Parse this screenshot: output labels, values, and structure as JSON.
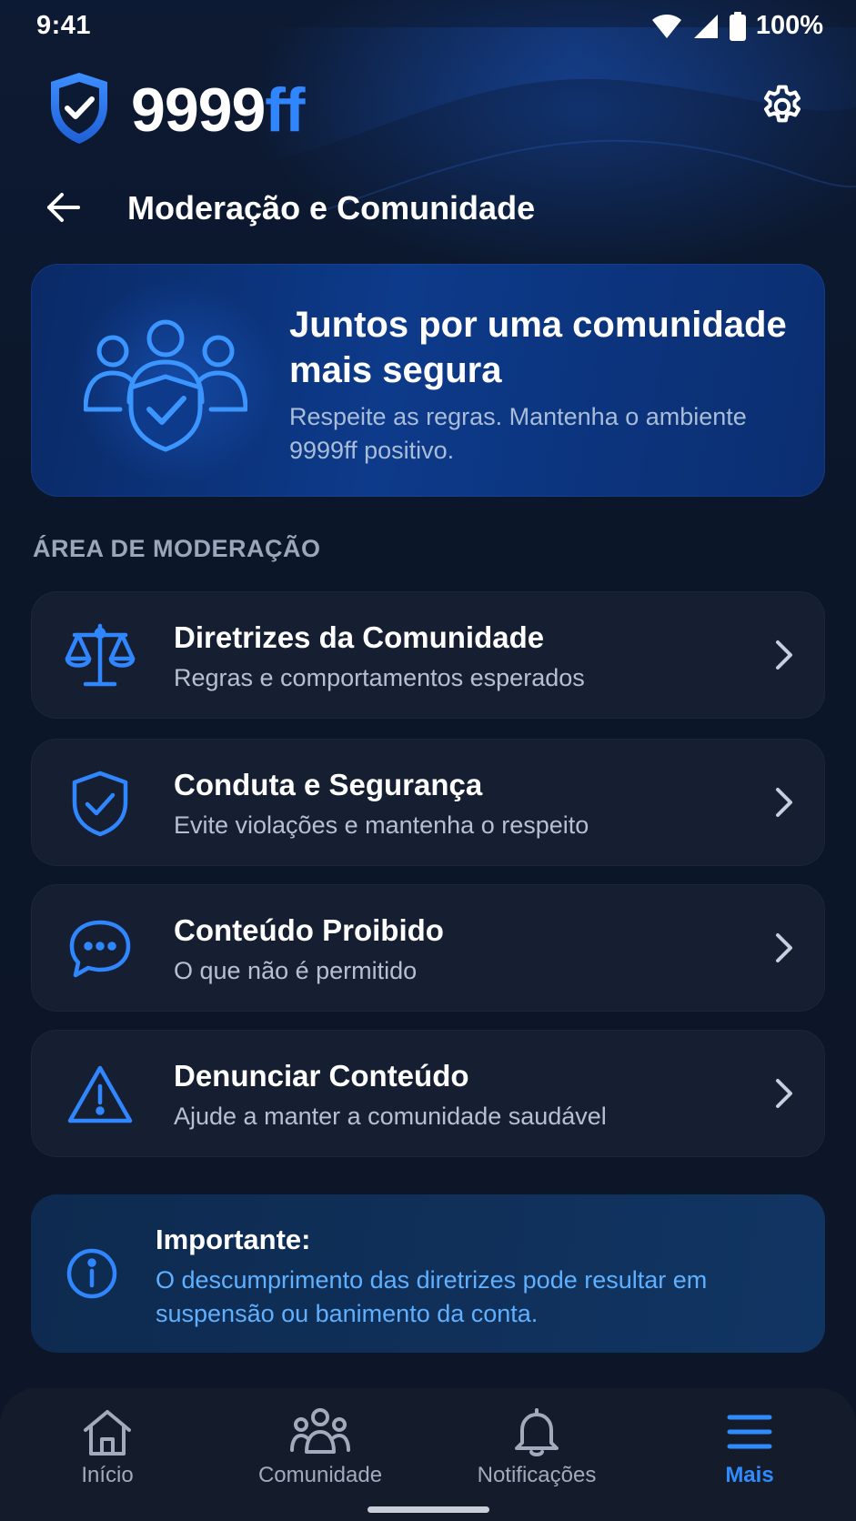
{
  "status_bar": {
    "time": "9:41",
    "battery": "100%"
  },
  "header": {
    "brand_main": "9999",
    "brand_accent": "ff"
  },
  "page": {
    "title": "Moderação e Comunidade"
  },
  "hero": {
    "title": "Juntos por uma comunidade mais segura",
    "subtitle": "Respeite as regras. Mantenha o ambiente 9999ff positivo."
  },
  "section": {
    "label": "ÁREA DE MODERAÇÃO"
  },
  "items": [
    {
      "title": "Diretrizes da Comunidade",
      "subtitle": "Regras e comportamentos esperados",
      "icon": "scale-icon"
    },
    {
      "title": "Conduta e Segurança",
      "subtitle": "Evite violações e mantenha o respeito",
      "icon": "shield-check-icon"
    },
    {
      "title": "Conteúdo Proibido",
      "subtitle": "O que não é permitido",
      "icon": "chat-bubble-icon"
    },
    {
      "title": "Denunciar Conteúdo",
      "subtitle": "Ajude a manter a comunidade saudável",
      "icon": "warning-icon"
    }
  ],
  "info": {
    "title": "Importante:",
    "text": "O descumprimento das diretrizes pode resultar em suspensão ou banimento da conta."
  },
  "nav": [
    {
      "label": "Início",
      "icon": "home-icon",
      "active": false
    },
    {
      "label": "Comunidade",
      "icon": "people-icon",
      "active": false
    },
    {
      "label": "Notificações",
      "icon": "bell-icon",
      "active": false
    },
    {
      "label": "Mais",
      "icon": "menu-icon",
      "active": true
    }
  ],
  "colors": {
    "accent": "#2f86ff",
    "background": "#0c1628",
    "card": "#161f31",
    "info_text": "#5fb0ff"
  }
}
